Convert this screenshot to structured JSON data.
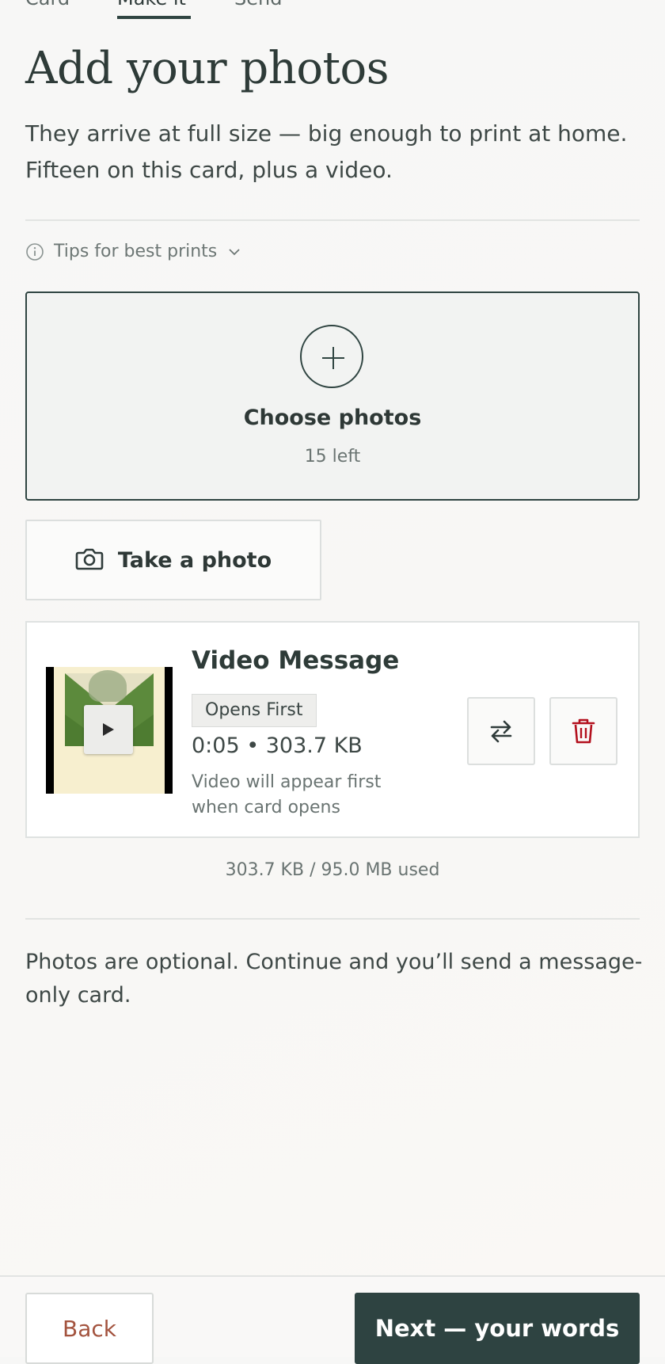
{
  "tabs": [
    {
      "label": "Card"
    },
    {
      "label": "Make it",
      "active": true
    },
    {
      "label": "Send"
    }
  ],
  "header": {
    "title": "Add your photos",
    "subtitle": "They arrive at full size — big enough to print at home. Fifteen on this card, plus a video."
  },
  "tips": {
    "label": "Tips for best prints",
    "icon": "info-icon",
    "chevron": "chevron-down-icon"
  },
  "upload": {
    "label": "Choose photos",
    "remaining": "15 left",
    "icon": "plus-icon"
  },
  "camera": {
    "label": "Take a photo",
    "icon": "camera-icon"
  },
  "video": {
    "title": "Video Message",
    "badge": "Opens First",
    "meta": "0:05 • 303.7 KB",
    "note": "Video will appear first when card opens",
    "actions": [
      {
        "name": "replace",
        "icon": "swap-icon"
      },
      {
        "name": "delete",
        "icon": "trash-icon",
        "color": "#b3101e"
      }
    ]
  },
  "storage": {
    "usage": "303.7 KB / 95.0 MB used"
  },
  "optional_note": "Photos are optional. Continue and you’ll send a message-only card.",
  "footer": {
    "back_label": "Back",
    "next_label": "Next — your words"
  },
  "colors": {
    "accent": "#2e4341",
    "back_text": "#a3533e",
    "delete": "#b3101e"
  }
}
